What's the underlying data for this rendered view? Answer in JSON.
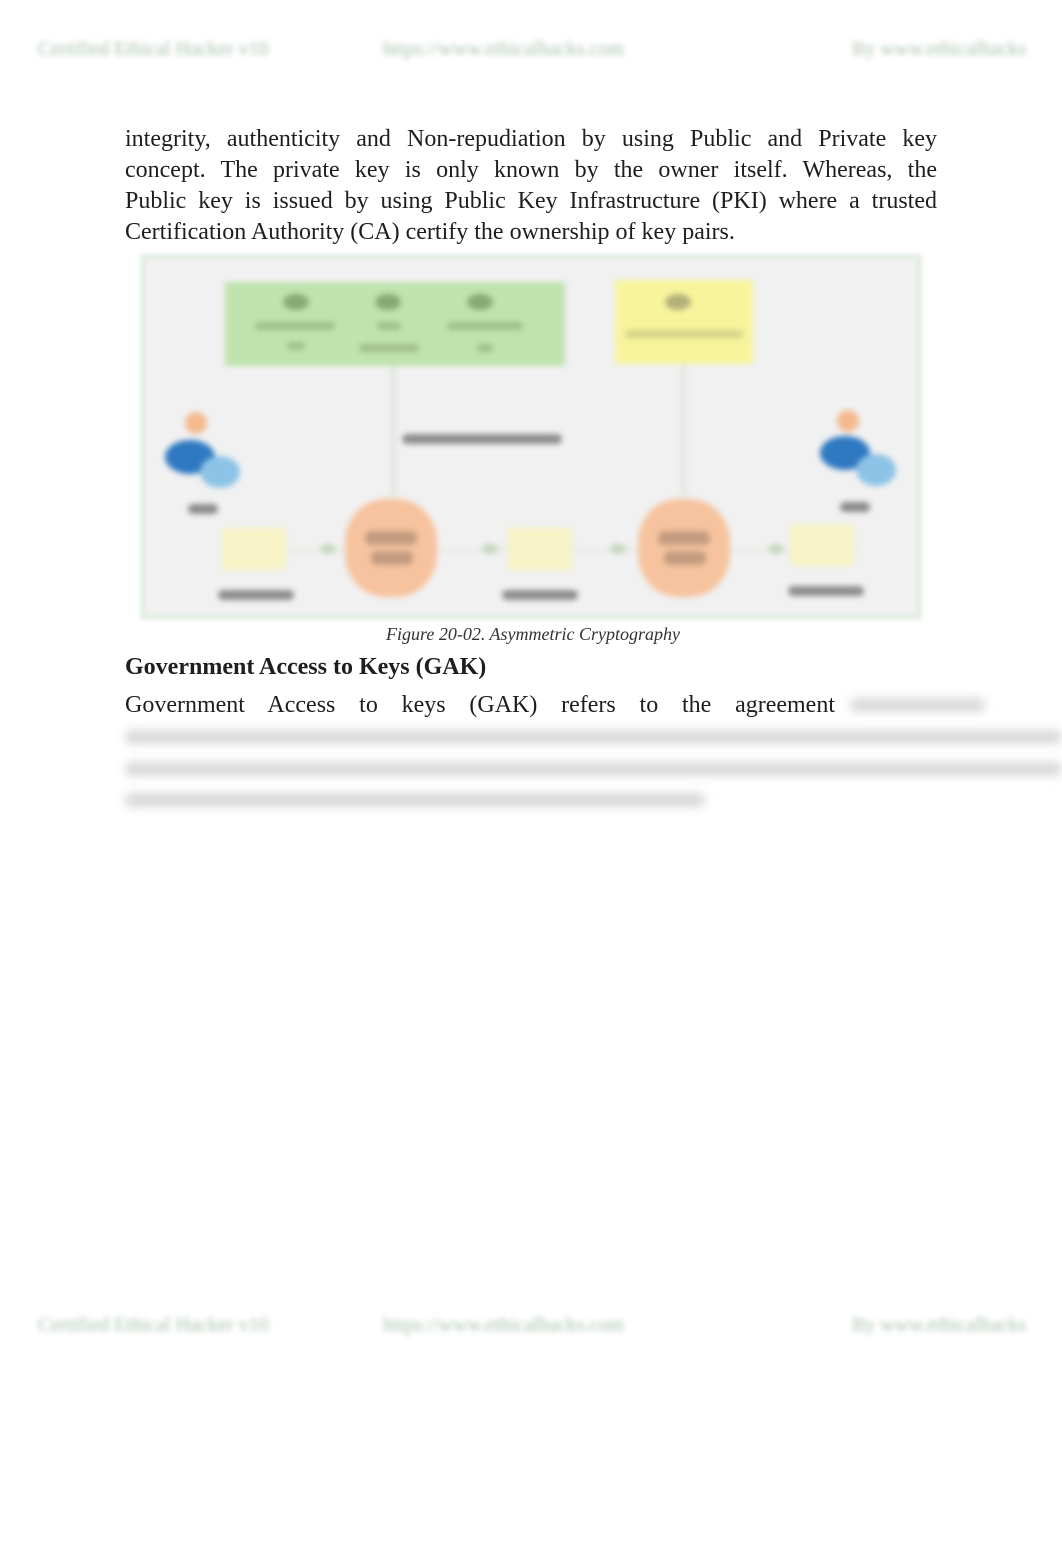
{
  "header": {
    "left": "Certified Ethical Hacker v10",
    "center": "https://www.ethicalhacks.com",
    "right": "By www.ethicalhacks"
  },
  "footer": {
    "left": "Certified Ethical Hacker v10",
    "center": "https://www.ethicalhacks.com",
    "right": "By www.ethicalhacks"
  },
  "body": {
    "paragraph1_lines": [
      "integrity, authenticity and Non-repudiation by using Public and Private key",
      "concept. The private key is only known by the owner itself. Whereas, the",
      "Public key is issued by using Public Key Infrastructure (PKI) where a trusted",
      "Certification Authority (CA) certify the ownership of key pairs."
    ],
    "figure_caption": "Figure 20-02. Asymmetric Cryptography",
    "section_heading": "Government Access to Keys (GAK)",
    "paragraph2_visible": "Government Access to keys (GAK) refers to the agreement"
  },
  "figure": {
    "colors": {
      "key_group_box": "#bfe2ae",
      "single_key_box": "#f7f49c",
      "algorithm_node": "#f6c39e",
      "text_node": "#f7f3c6",
      "person": "#2f79c2"
    },
    "blurred": true
  }
}
